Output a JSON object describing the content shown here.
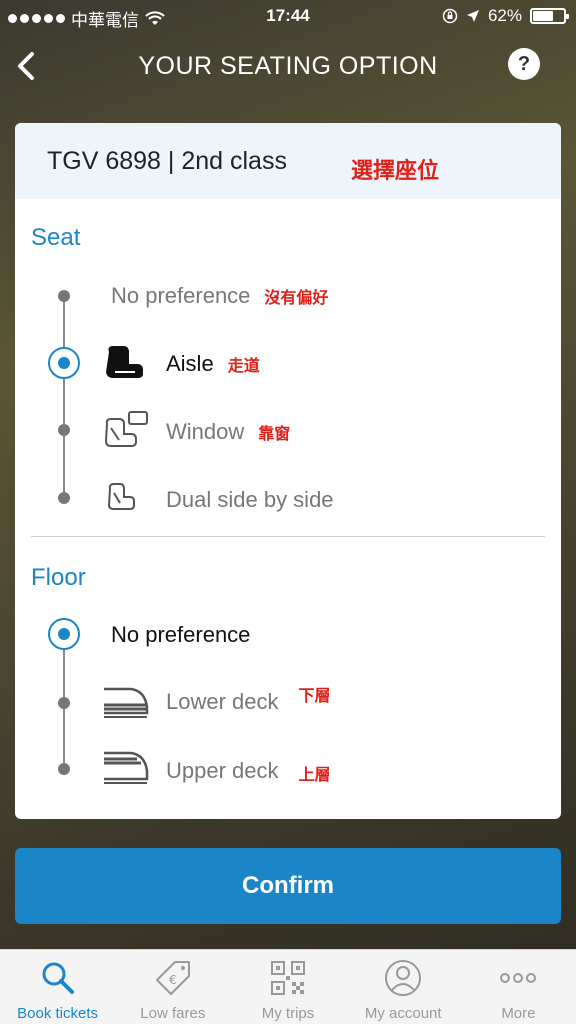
{
  "status_bar": {
    "carrier": "中華電信",
    "time": "17:44",
    "battery": "62%",
    "battery_level": 0.62
  },
  "nav": {
    "title": "YOUR SEATING OPTION",
    "help": "?"
  },
  "card": {
    "train": "TGV 6898 | 2nd class",
    "train_note": "選擇座位"
  },
  "seat": {
    "title": "Seat",
    "options": [
      {
        "label": "No preference",
        "note": "沒有偏好",
        "icon": "none",
        "selected": false
      },
      {
        "label": "Aisle",
        "note": "走道",
        "icon": "aisle-seat-icon",
        "selected": true
      },
      {
        "label": "Window",
        "note": "靠窗",
        "icon": "window-seat-icon",
        "selected": false
      },
      {
        "label": "Dual side by side",
        "note": "",
        "icon": "dual-seat-icon",
        "selected": false
      }
    ]
  },
  "floor": {
    "title": "Floor",
    "options": [
      {
        "label": "No preference",
        "note": "",
        "icon": "none",
        "selected": true
      },
      {
        "label": "Lower deck",
        "note": "下層",
        "icon": "lower-deck-train-icon",
        "selected": false
      },
      {
        "label": "Upper deck",
        "note": "上層",
        "icon": "upper-deck-train-icon",
        "selected": false
      }
    ]
  },
  "confirm_label": "Confirm",
  "tabs": [
    {
      "label": "Book tickets",
      "icon": "search-icon",
      "active": true
    },
    {
      "label": "Low fares",
      "icon": "price-tag-icon",
      "active": false
    },
    {
      "label": "My trips",
      "icon": "qr-code-icon",
      "active": false
    },
    {
      "label": "My account",
      "icon": "user-icon",
      "active": false
    },
    {
      "label": "More",
      "icon": "more-dots-icon",
      "active": false
    }
  ],
  "colors": {
    "accent": "#1a86c8",
    "annotation": "#e0211b"
  }
}
